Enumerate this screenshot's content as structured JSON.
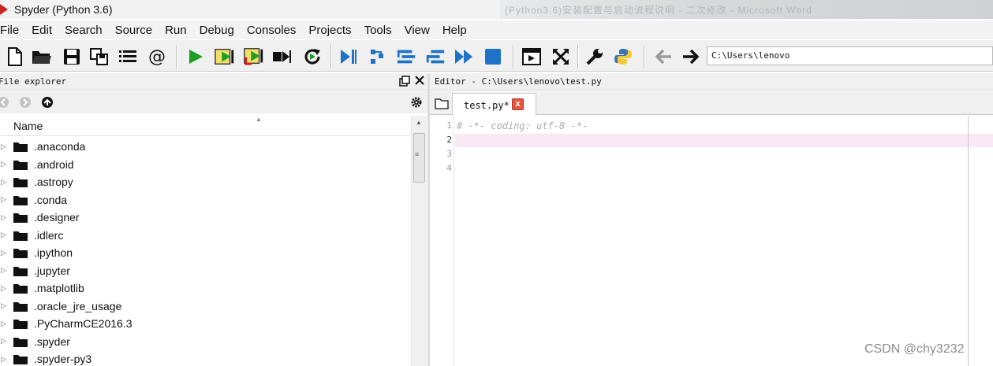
{
  "window": {
    "title": "Spyder (Python 3.6)",
    "background_title": "(Python3.6)安装配置与启动流程说明 - 二次修改 - Microsoft Word"
  },
  "menu": [
    "File",
    "Edit",
    "Search",
    "Source",
    "Run",
    "Debug",
    "Consoles",
    "Projects",
    "Tools",
    "View",
    "Help"
  ],
  "toolbar": {
    "working_dir": "C:\\Users\\lenovo"
  },
  "file_explorer": {
    "title": "File explorer",
    "column_name": "Name",
    "items": [
      ".anaconda",
      ".android",
      ".astropy",
      ".conda",
      ".designer",
      ".idlerc",
      ".ipython",
      ".jupyter",
      ".matplotlib",
      ".oracle_jre_usage",
      ".PyCharmCE2016.3",
      ".spyder",
      ".spyder-py3"
    ]
  },
  "editor": {
    "title": "Editor - C:\\Users\\lenovo\\test.py",
    "tab_label": "test.py*",
    "tab_close": "x",
    "line_numbers": [
      "1",
      "2",
      "3",
      "4"
    ],
    "lines": [
      "# -*- coding: utf-8 -*-",
      "",
      "",
      ""
    ],
    "current_line": 2
  },
  "watermark": "CSDN @chy3232",
  "colors": {
    "accent_run": "#1e9e24",
    "accent_blue": "#1f73c7",
    "current_line": "#f9e9f5",
    "tab_close": "#e8553f"
  }
}
